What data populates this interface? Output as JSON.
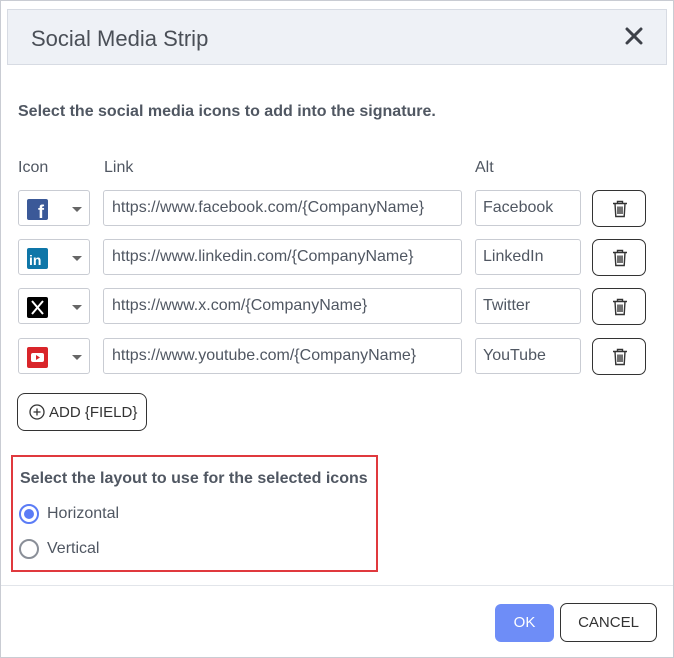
{
  "dialog": {
    "title": "Social Media Strip",
    "instruction": "Select the social media icons to add into the signature."
  },
  "columns": {
    "icon": "Icon",
    "link": "Link",
    "alt": "Alt"
  },
  "rows": [
    {
      "icon": "facebook-icon",
      "icon_color": "#3b5998",
      "link": "https://www.facebook.com/{CompanyName}",
      "alt": "Facebook"
    },
    {
      "icon": "linkedin-icon",
      "icon_color": "#0e76a8",
      "link": "https://www.linkedin.com/{CompanyName}",
      "alt": "LinkedIn"
    },
    {
      "icon": "x-icon",
      "icon_color": "#000000",
      "link": "https://www.x.com/{CompanyName}",
      "alt": "Twitter"
    },
    {
      "icon": "youtube-icon",
      "icon_color": "#d9252a",
      "link": "https://www.youtube.com/{CompanyName}",
      "alt": "YouTube"
    }
  ],
  "add_button": {
    "label": "ADD {FIELD}"
  },
  "layout": {
    "title": "Select the layout to use for the selected icons",
    "options": [
      {
        "label": "Horizontal",
        "selected": true
      },
      {
        "label": "Vertical",
        "selected": false
      }
    ]
  },
  "footer": {
    "ok_label": "OK",
    "cancel_label": "CANCEL"
  },
  "colors": {
    "accent": "#6e8df7",
    "highlight_border": "#e0393e"
  }
}
